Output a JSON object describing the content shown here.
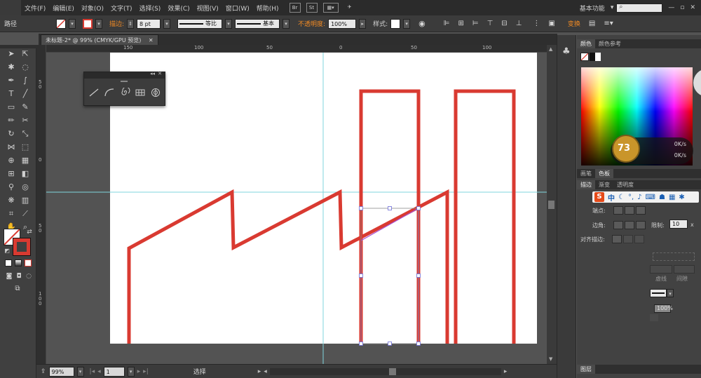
{
  "menubar": {
    "items": [
      "文件(F)",
      "编辑(E)",
      "对象(O)",
      "文字(T)",
      "选择(S)",
      "效果(C)",
      "视图(V)",
      "窗口(W)",
      "帮助(H)"
    ],
    "chip_br": "Br",
    "chip_st": "St",
    "workspace": "基本功能",
    "search_placeholder": ""
  },
  "controlbar": {
    "label": "路径",
    "stroke_label": "描边:",
    "stroke_value": "8 pt",
    "profile1": "等比",
    "profile2": "基本",
    "opacity_label": "不透明度:",
    "opacity_value": "100%",
    "style_label": "样式:",
    "transform_label": "变换"
  },
  "document": {
    "tab_title": "未标题-2* @ 99% (CMYK/GPU 预览)"
  },
  "rulers": {
    "top": [
      "150",
      "100",
      "50",
      "0",
      "50",
      "100"
    ],
    "left": [
      "5 0",
      "0",
      "5 0",
      "1 0 0"
    ]
  },
  "statusbar": {
    "zoom": "99%",
    "page": "1",
    "mode": "选择"
  },
  "panels": {
    "color_tabs": [
      "颜色",
      "颜色参考"
    ],
    "mid_tabs": [
      "画笔",
      "色板"
    ],
    "stroke_tabs": [
      "描边",
      "渐变",
      "透明度"
    ],
    "ime_logo": "S",
    "ime_text": "中",
    "cap_label": "端点:",
    "corner_label": "边角:",
    "limit_label": "限制:",
    "limit_value": "10",
    "limit_unit": "x",
    "align_label": "对齐描边:",
    "dashed_label": "虚线",
    "gap_label": "间隙",
    "pct_value": "100%",
    "layers_tab": "图层",
    "kbs_top": "0K/s",
    "kbs_bottom": "0K/s",
    "badge_value": "73"
  },
  "colors": {
    "stroke_red": "#d93a31",
    "guide_cyan": "#7fd6dc",
    "selection_purple": "#a64fd3",
    "accent_orange": "#f08a24"
  }
}
